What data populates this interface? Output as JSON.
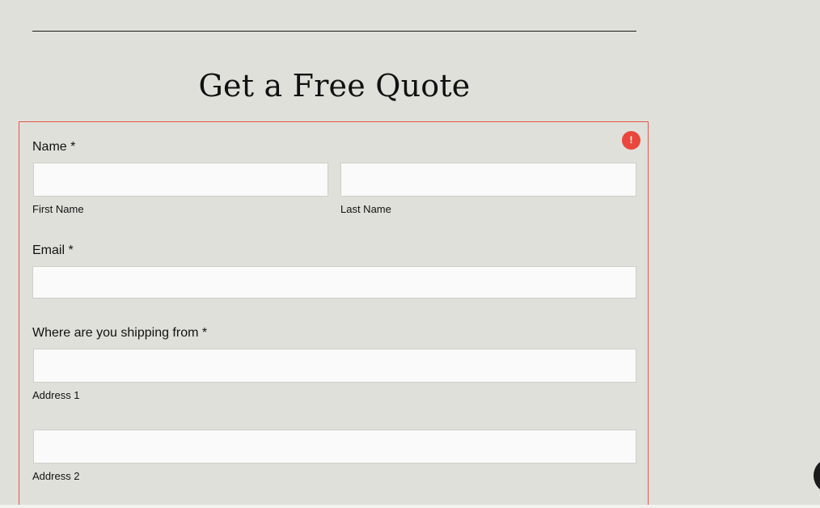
{
  "page": {
    "title": "Get a Free Quote"
  },
  "form": {
    "error_icon_glyph": "!",
    "name": {
      "label": "Name *",
      "first_name_value": "",
      "first_name_sublabel": "First Name",
      "last_name_value": "",
      "last_name_sublabel": "Last Name"
    },
    "email": {
      "label": "Email *",
      "value": ""
    },
    "shipping_from": {
      "label": "Where are you shipping from *",
      "address1_value": "",
      "address1_sublabel": "Address 1",
      "address2_value": "",
      "address2_sublabel": "Address 2"
    }
  },
  "colors": {
    "background": "#e0e0da",
    "error_border": "#e3564b",
    "error_badge": "#e9473d",
    "input_background": "#fafafa",
    "text": "#111111"
  }
}
